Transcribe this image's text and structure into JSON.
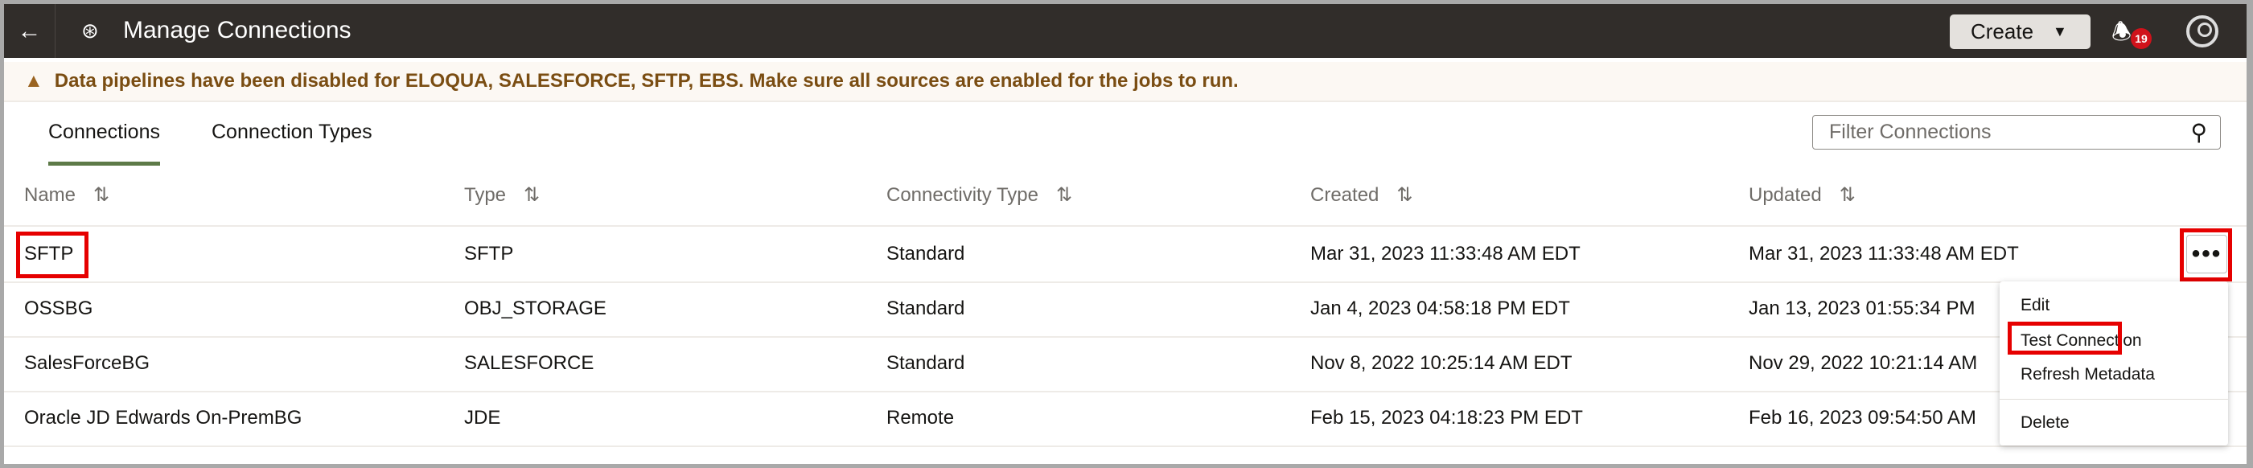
{
  "header": {
    "title": "Manage Connections",
    "create_label": "Create",
    "notification_count": "19"
  },
  "banner": {
    "message": "Data pipelines have been disabled for ELOQUA, SALESFORCE, SFTP, EBS. Make sure all sources are enabled for the jobs to run."
  },
  "tabs": [
    {
      "label": "Connections",
      "active": true
    },
    {
      "label": "Connection Types",
      "active": false
    }
  ],
  "filter": {
    "placeholder": "Filter Connections"
  },
  "table": {
    "columns": [
      "Name",
      "Type",
      "Connectivity Type",
      "Created",
      "Updated"
    ],
    "rows": [
      {
        "name": "SFTP",
        "type": "SFTP",
        "connectivity": "Standard",
        "created": "Mar 31, 2023 11:33:48 AM EDT",
        "updated": "Mar 31, 2023 11:33:48 AM EDT"
      },
      {
        "name": "OSSBG",
        "type": "OBJ_STORAGE",
        "connectivity": "Standard",
        "created": "Jan 4, 2023 04:58:18 PM EDT",
        "updated": "Jan 13, 2023 01:55:34 PM"
      },
      {
        "name": "SalesForceBG",
        "type": "SALESFORCE",
        "connectivity": "Standard",
        "created": "Nov 8, 2022 10:25:14 AM EDT",
        "updated": "Nov 29, 2022 10:21:14 AM"
      },
      {
        "name": "Oracle JD Edwards On-PremBG",
        "type": "JDE",
        "connectivity": "Remote",
        "created": "Feb 15, 2023 04:18:23 PM EDT",
        "updated": "Feb 16, 2023 09:54:50 AM"
      }
    ]
  },
  "context_menu": {
    "items": [
      "Edit",
      "Test Connection",
      "Refresh Metadata",
      "Delete"
    ]
  },
  "colors": {
    "header_bg": "#312d2a",
    "highlight": "#e60000",
    "tab_underline": "#5d7a48",
    "banner_text": "#7a4d12"
  }
}
